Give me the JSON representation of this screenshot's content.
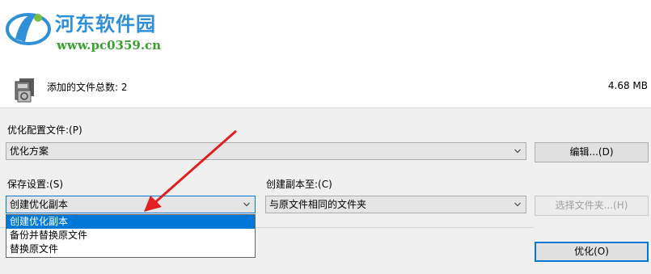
{
  "watermark": {
    "title": "河东软件园",
    "url": "www.pc0359.cn"
  },
  "file_summary": {
    "count_label": "添加的文件总数: 2",
    "total_size": "4.68 MB"
  },
  "profile": {
    "label": "优化配置文件:(P)",
    "value": "优化方案",
    "edit_button": "编辑...(D)"
  },
  "save_settings": {
    "label": "保存设置:(S)",
    "value": "创建优化副本",
    "options": [
      "创建优化副本",
      "备份并替换原文件",
      "替换原文件"
    ]
  },
  "copy_to": {
    "label": "创建副本至:(C)",
    "value": "与原文件相同的文件夹",
    "choose_folder_button": "选择文件夹...(H)"
  },
  "optimize_button": "优化(O)",
  "colors": {
    "accent": "#0078d7",
    "annotation_arrow": "#e02020",
    "watermark_blue": "#2f8fd8",
    "watermark_green": "#39a02f"
  }
}
